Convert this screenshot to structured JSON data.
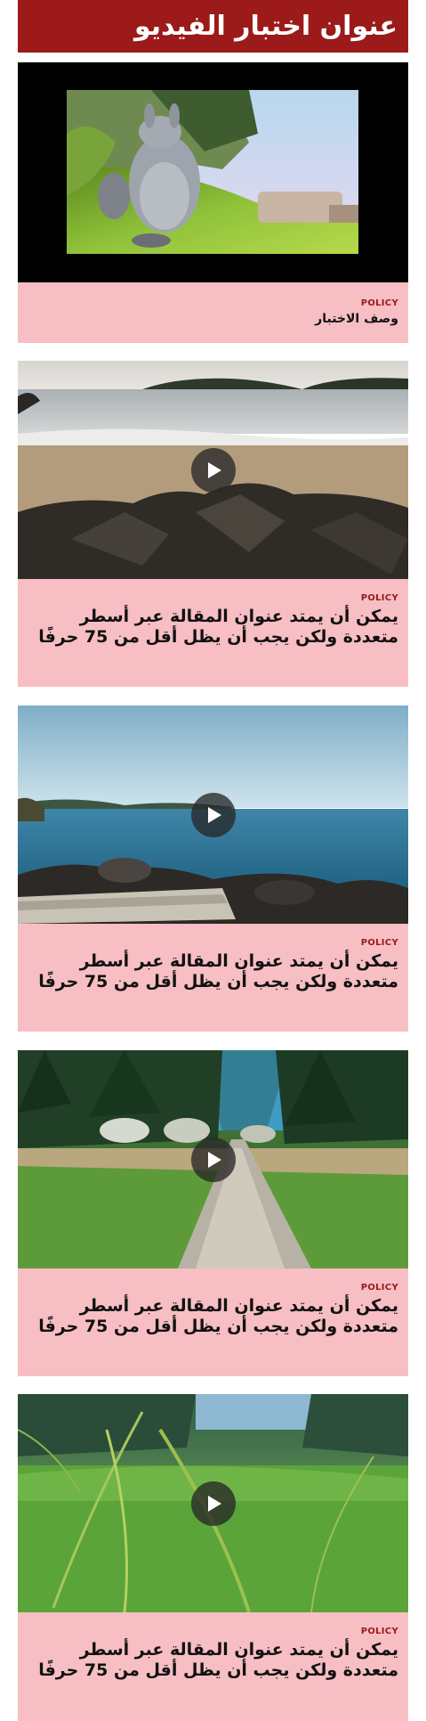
{
  "header": {
    "title": "عنوان اختبار الفيديو"
  },
  "featured": {
    "tag": "POLICY",
    "description": "وصف الاختبار",
    "video_frame": "cartoon-bunny-video-frame"
  },
  "articles": [
    {
      "tag": "POLICY",
      "title": "يمكن أن يمتد عنوان المقالة عبر أسطر متعددة ولكن يجب أن يظل أقل من 75 حرفًا",
      "image": "beach-rocks-photo",
      "icon": "play-icon"
    },
    {
      "tag": "POLICY",
      "title": "يمكن أن يمتد عنوان المقالة عبر أسطر متعددة ولكن يجب أن يظل أقل من 75 حرفًا",
      "image": "sea-shore-photo",
      "icon": "play-icon"
    },
    {
      "tag": "POLICY",
      "title": "يمكن أن يمتد عنوان المقالة عبر أسطر متعددة ولكن يجب أن يظل أقل من 75 حرفًا",
      "image": "forest-path-photo",
      "icon": "play-icon"
    },
    {
      "tag": "POLICY",
      "title": "يمكن أن يمتد عنوان المقالة عبر أسطر متعددة ولكن يجب أن يظل أقل من 75 حرفًا",
      "image": "grass-field-photo",
      "icon": "play-icon"
    }
  ],
  "colors": {
    "header_bg": "#9c1a1a",
    "caption_bg": "#f7bec4",
    "tag_text": "#9c1a1a"
  }
}
